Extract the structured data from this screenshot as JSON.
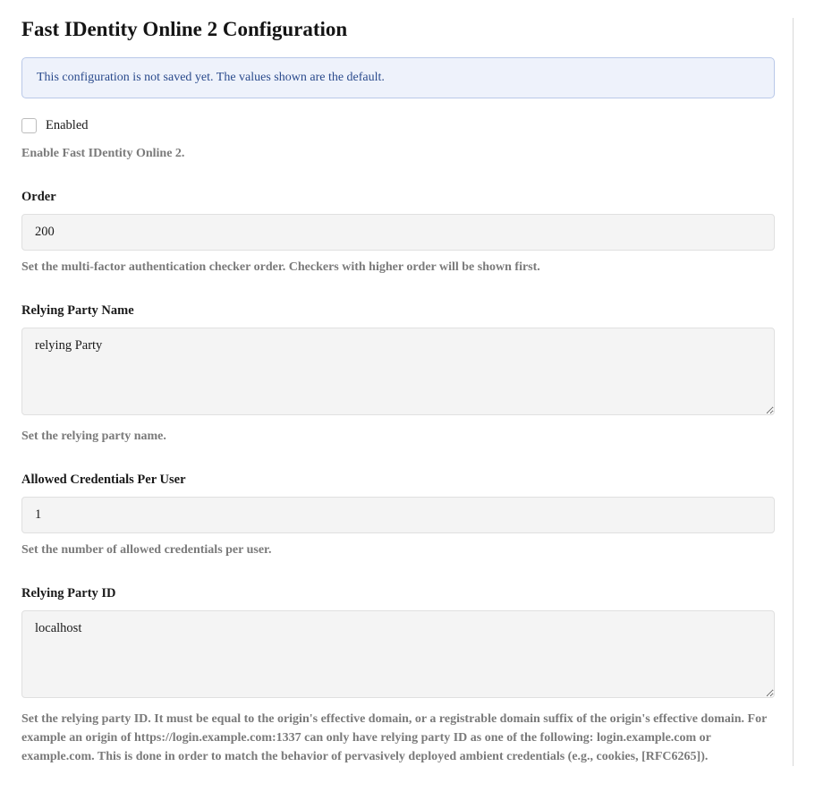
{
  "page": {
    "title": "Fast IDentity Online 2 Configuration"
  },
  "alert": {
    "message": "This configuration is not saved yet. The values shown are the default."
  },
  "fields": {
    "enabled": {
      "label": "Enabled",
      "checked": false,
      "help": "Enable Fast IDentity Online 2."
    },
    "order": {
      "label": "Order",
      "value": "200",
      "help": "Set the multi-factor authentication checker order. Checkers with higher order will be shown first."
    },
    "relyingPartyName": {
      "label": "Relying Party Name",
      "value": "relying Party",
      "help": "Set the relying party name."
    },
    "allowedCredentials": {
      "label": "Allowed Credentials Per User",
      "value": "1",
      "help": "Set the number of allowed credentials per user."
    },
    "relyingPartyId": {
      "label": "Relying Party ID",
      "value": "localhost",
      "help": "Set the relying party ID. It must be equal to the origin's effective domain, or a registrable domain suffix of the origin's effective domain. For example an origin of https://login.example.com:1337 can only have relying party ID as one of the following: login.example.com or example.com. This is done in order to match the behavior of pervasively deployed ambient credentials (e.g., cookies, [RFC6265])."
    }
  }
}
